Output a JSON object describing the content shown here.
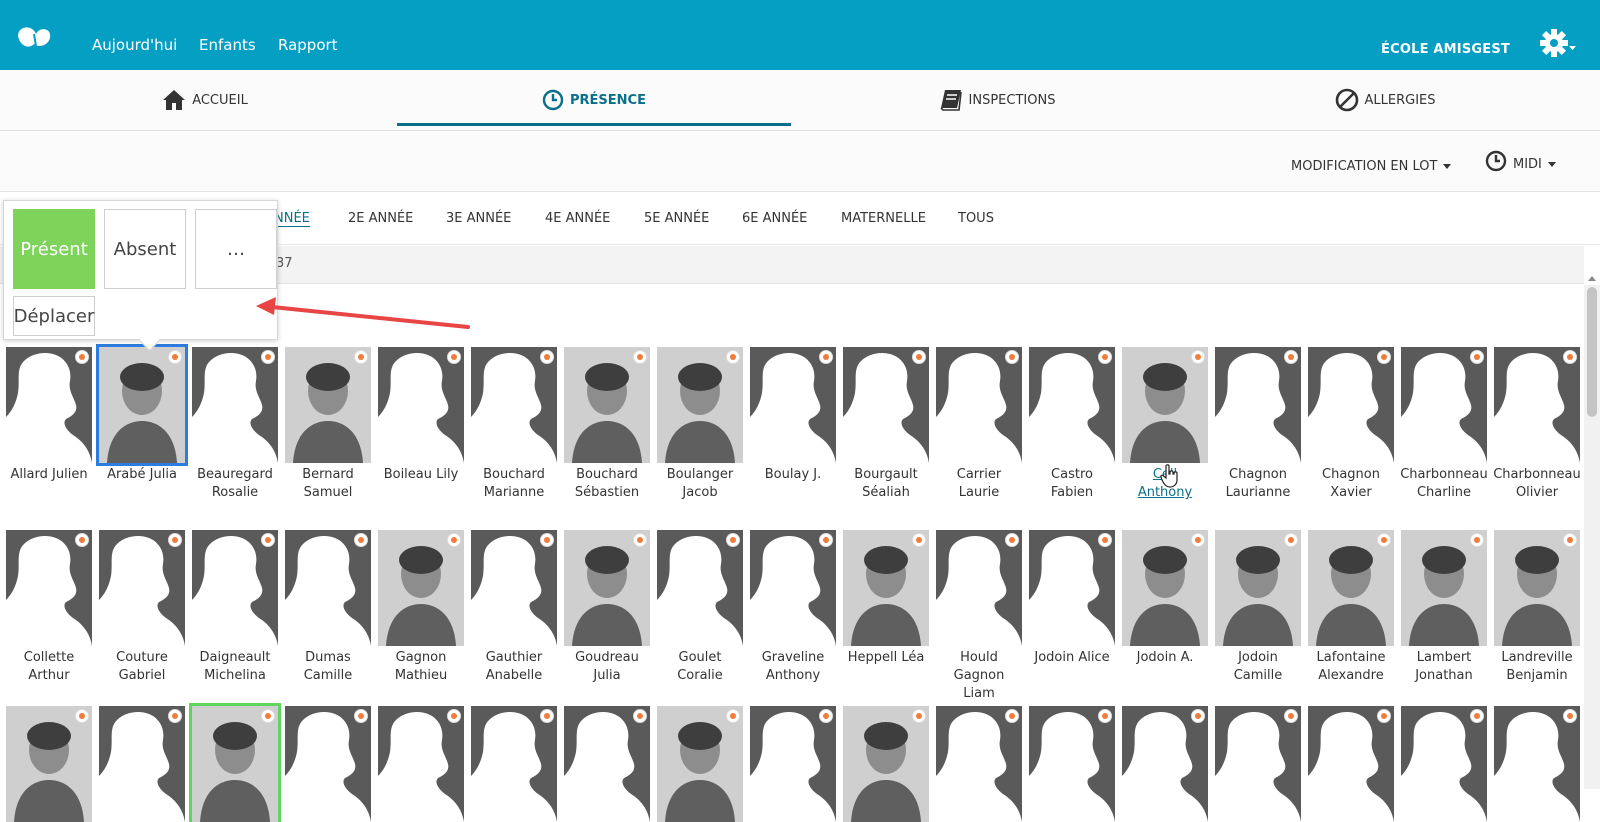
{
  "app": {
    "nav": [
      "Aujourd'hui",
      "Enfants",
      "Rapport"
    ],
    "school": "ÉCOLE AMISGEST",
    "colors": {
      "primary": "#069fc4",
      "accent": "#0a6f8a",
      "present": "#7ed35b"
    }
  },
  "tabs": [
    {
      "label": "ACCUEIL",
      "icon": "home-icon"
    },
    {
      "label": "PRÉSENCE",
      "icon": "clock-icon",
      "active": true
    },
    {
      "label": "INSPECTIONS",
      "icon": "book-icon"
    },
    {
      "label": "ALLERGIES",
      "icon": "ban-icon"
    }
  ],
  "toolbar": {
    "batch": "MODIFICATION EN LOT",
    "period": "MIDI"
  },
  "grades": [
    "NNÉE",
    "2E ANNÉE",
    "3E ANNÉE",
    "4E ANNÉE",
    "5E ANNÉE",
    "6E ANNÉE",
    "MATERNELLE",
    "TOUS"
  ],
  "info": "37",
  "popup": {
    "present": "Présent",
    "absent": "Absent",
    "more": "…",
    "move": "Déplacer"
  },
  "children": [
    [
      {
        "l1": "Allard Julien",
        "l2": ""
      },
      {
        "l1": "Arabé Julia",
        "l2": "",
        "photo": true,
        "sel": "blue"
      },
      {
        "l1": "Beauregard",
        "l2": "Rosalie"
      },
      {
        "l1": "Bernard",
        "l2": "Samuel",
        "photo": true
      },
      {
        "l1": "Boileau Lily",
        "l2": ""
      },
      {
        "l1": "Bouchard",
        "l2": "Marianne"
      },
      {
        "l1": "Bouchard",
        "l2": "Sébastien",
        "photo": true
      },
      {
        "l1": "Boulanger",
        "l2": "Jacob",
        "photo": true
      },
      {
        "l1": "Boulay J.",
        "l2": ""
      },
      {
        "l1": "Bourgault",
        "l2": "Séaliah"
      },
      {
        "l1": "Carrier",
        "l2": "Laurie"
      },
      {
        "l1": "Castro",
        "l2": "Fabien"
      },
      {
        "l1": "Cell",
        "l2": "Anthony",
        "photo": true,
        "link": true
      },
      {
        "l1": "Chagnon",
        "l2": "Laurianne"
      },
      {
        "l1": "Chagnon",
        "l2": "Xavier"
      },
      {
        "l1": "Charbonneau",
        "l2": "Charline"
      },
      {
        "l1": "Charbonneau",
        "l2": "Olivier"
      }
    ],
    [
      {
        "l1": "Collette",
        "l2": "Arthur"
      },
      {
        "l1": "Couture",
        "l2": "Gabriel"
      },
      {
        "l1": "Daigneault",
        "l2": "Michelina"
      },
      {
        "l1": "Dumas",
        "l2": "Camille"
      },
      {
        "l1": "Gagnon",
        "l2": "Mathieu",
        "photo": true
      },
      {
        "l1": "Gauthier",
        "l2": "Anabelle"
      },
      {
        "l1": "Goudreau",
        "l2": "Julia",
        "photo": true
      },
      {
        "l1": "Goulet",
        "l2": "Coralie"
      },
      {
        "l1": "Graveline",
        "l2": "Anthony"
      },
      {
        "l1": "Heppell Léa",
        "l2": "",
        "photo": true
      },
      {
        "l1": "Hould",
        "l2": "Gagnon",
        "l3": "Liam"
      },
      {
        "l1": "Jodoin Alice",
        "l2": ""
      },
      {
        "l1": "Jodoin A.",
        "l2": "",
        "photo": true
      },
      {
        "l1": "Jodoin",
        "l2": "Camille",
        "photo": true
      },
      {
        "l1": "Lafontaine",
        "l2": "Alexandre",
        "photo": true
      },
      {
        "l1": "Lambert",
        "l2": "Jonathan",
        "photo": true
      },
      {
        "l1": "Landreville",
        "l2": "Benjamin",
        "photo": true
      }
    ],
    [
      {
        "l1": "",
        "l2": "",
        "photo": true
      },
      {
        "l1": "",
        "l2": ""
      },
      {
        "l1": "",
        "l2": "",
        "photo": true,
        "sel": "green"
      },
      {
        "l1": "",
        "l2": ""
      },
      {
        "l1": "",
        "l2": ""
      },
      {
        "l1": "",
        "l2": ""
      },
      {
        "l1": "",
        "l2": ""
      },
      {
        "l1": "",
        "l2": "",
        "photo": true
      },
      {
        "l1": "",
        "l2": ""
      },
      {
        "l1": "",
        "l2": "",
        "photo": true
      },
      {
        "l1": "",
        "l2": ""
      },
      {
        "l1": "",
        "l2": ""
      },
      {
        "l1": "",
        "l2": ""
      },
      {
        "l1": "",
        "l2": ""
      },
      {
        "l1": "",
        "l2": ""
      },
      {
        "l1": "",
        "l2": ""
      },
      {
        "l1": "",
        "l2": ""
      }
    ]
  ]
}
